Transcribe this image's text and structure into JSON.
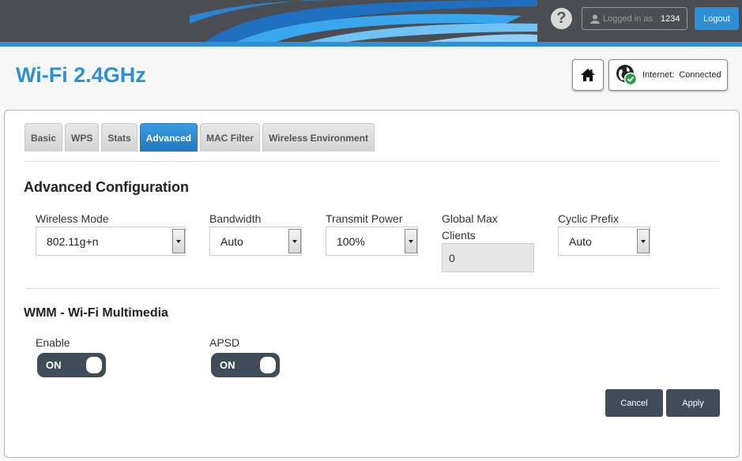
{
  "header": {
    "help_label": "?",
    "logged_in_label": "Logged in as",
    "logged_in_user": "1234",
    "logout_label": "Logout"
  },
  "page": {
    "title": "Wi-Fi 2.4GHz",
    "internet_label": "Internet:",
    "internet_status": "Connected"
  },
  "tabs": [
    {
      "label": "Basic",
      "active": false
    },
    {
      "label": "WPS",
      "active": false
    },
    {
      "label": "Stats",
      "active": false
    },
    {
      "label": "Advanced",
      "active": true
    },
    {
      "label": "MAC Filter",
      "active": false
    },
    {
      "label": "Wireless Environment",
      "active": false
    }
  ],
  "advanced": {
    "title": "Advanced Configuration",
    "wireless_mode": {
      "label": "Wireless Mode",
      "value": "802.11g+n"
    },
    "bandwidth": {
      "label": "Bandwidth",
      "value": "Auto"
    },
    "transmit_power": {
      "label": "Transmit Power",
      "value": "100%"
    },
    "global_max_clients": {
      "label_line1": "Global Max",
      "label_line2": "Clients",
      "value": "0"
    },
    "cyclic_prefix": {
      "label": "Cyclic Prefix",
      "value": "Auto"
    }
  },
  "wmm": {
    "title": "WMM - Wi-Fi Multimedia",
    "enable": {
      "label": "Enable",
      "state": "ON"
    },
    "apsd": {
      "label": "APSD",
      "state": "ON"
    }
  },
  "actions": {
    "cancel_label": "Cancel",
    "apply_label": "Apply"
  },
  "colors": {
    "accent": "#2f8fd6",
    "topbar": "#4a4d52",
    "button_dark": "#3f4d5a",
    "status_ok": "#2a9d4a"
  },
  "icons": {
    "help": "question-mark-icon",
    "user": "user-icon",
    "home": "home-icon",
    "internet": "globe-check-icon",
    "select_arrow": "chevron-down-icon"
  }
}
